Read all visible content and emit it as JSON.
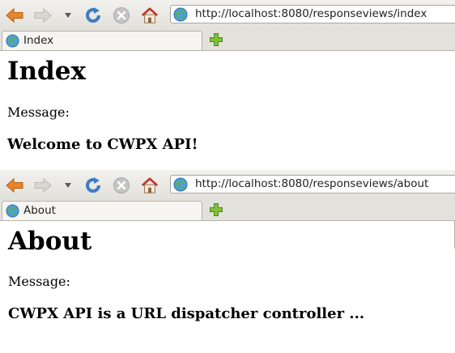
{
  "windows": [
    {
      "url": "http://localhost:8080/responseviews/index",
      "tab_title": "Index",
      "heading": "Index",
      "message_label": "Message:",
      "message": "Welcome to CWPX API!"
    },
    {
      "url": "http://localhost:8080/responseviews/about",
      "tab_title": "About",
      "heading": "About",
      "message_label": "Message:",
      "message": "CWPX API is a URL dispatcher controller ..."
    }
  ],
  "icons": {
    "back": "back-arrow-icon",
    "forward": "forward-arrow-icon",
    "history": "history-dropdown-icon",
    "reload": "reload-icon",
    "stop": "stop-icon",
    "home": "home-icon",
    "site": "globe-icon",
    "new_tab": "plus-icon"
  },
  "colors": {
    "toolbar_top": "#f2f1ee",
    "toolbar_bottom": "#e2e0da",
    "back_arrow": "#e8862a",
    "reload": "#3d7cc9",
    "stop": "#b9b9b9",
    "home_roof": "#c0392b",
    "new_tab": "#6fae2f"
  }
}
